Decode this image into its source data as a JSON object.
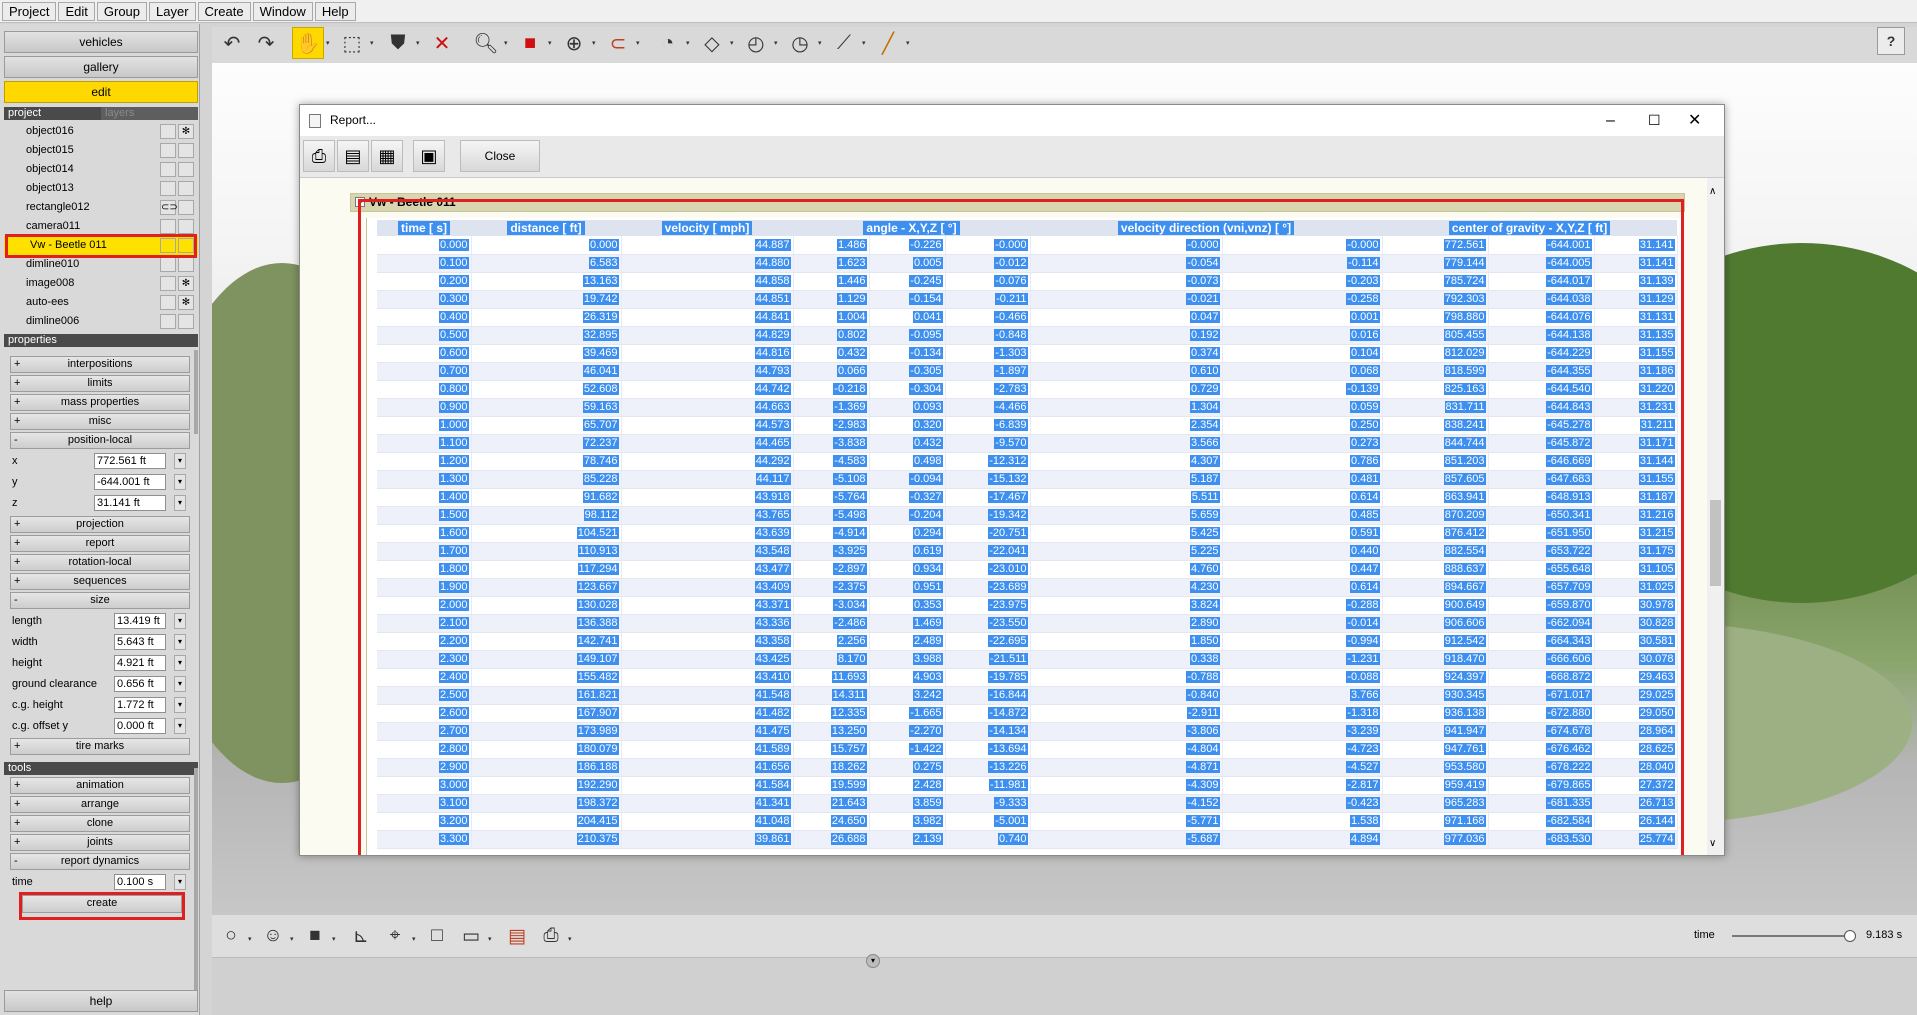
{
  "menu": [
    "Project",
    "Edit",
    "Group",
    "Layer",
    "Create",
    "Window",
    "Help"
  ],
  "left": {
    "nav": [
      "vehicles",
      "gallery",
      "edit"
    ],
    "tabs": {
      "project": "project",
      "layers": "layers"
    },
    "objects": [
      {
        "label": "object016",
        "flag": "snow"
      },
      {
        "label": "object015",
        "flag": ""
      },
      {
        "label": "object014",
        "flag": ""
      },
      {
        "label": "object013",
        "flag": ""
      },
      {
        "label": "rectangle012",
        "flag": "link"
      },
      {
        "label": "camera011",
        "flag": ""
      },
      {
        "label": "Vw - Beetle 011",
        "flag": ""
      },
      {
        "label": "dimline010",
        "flag": ""
      },
      {
        "label": "image008",
        "flag": "snow"
      },
      {
        "label": "auto-ees",
        "flag": "snow"
      },
      {
        "label": "dimline006",
        "flag": ""
      }
    ],
    "properties_label": "properties",
    "properties": {
      "interpositions": "interpositions",
      "limits": "limits",
      "mass_properties": "mass properties",
      "misc": "misc",
      "position_local": "position-local",
      "x_label": "x",
      "x": "772.561 ft",
      "y_label": "y",
      "y": "-644.001 ft",
      "z_label": "z",
      "z": "31.141 ft",
      "projection": "projection",
      "report": "report",
      "rotation_local": "rotation-local",
      "sequences": "sequences",
      "size": "size",
      "length_label": "length",
      "length": "13.419 ft",
      "width_label": "width",
      "width": "5.643 ft",
      "height_label": "height",
      "height": "4.921 ft",
      "ground_clearance_label": "ground clearance",
      "ground_clearance": "0.656 ft",
      "cg_height_label": "c.g. height",
      "cg_height": "1.772 ft",
      "cg_offset_label": "c.g. offset y",
      "cg_offset": "0.000 ft",
      "tire_marks": "tire marks"
    },
    "tools_label": "tools",
    "tools": {
      "animation": "animation",
      "arrange": "arrange",
      "clone": "clone",
      "joints": "joints",
      "report_dynamics": "report dynamics",
      "time_label": "time",
      "time": "0.100 s",
      "create": "create"
    },
    "help": "help"
  },
  "bottom": {
    "time_label": "time",
    "time_value": "9.183 s",
    "slider_fraction": 0.95
  },
  "dialog": {
    "title": "Report...",
    "close_label": "Close",
    "vehicle": "Vw - Beetle 011",
    "headers": [
      "time [ s]",
      "distance [ ft]",
      "velocity [ mph]",
      "angle - X,Y,Z [ °]",
      "velocity direction (vni,vnz) [ °]",
      "center of gravity - X,Y,Z [ ft]"
    ],
    "rows": [
      [
        "0.000",
        "0.000",
        "44.887",
        "1.486",
        "-0.226",
        "-0.000",
        "-0.000",
        "-0.000",
        "772.561",
        "-644.001",
        "31.141"
      ],
      [
        "0.100",
        "6.583",
        "44.880",
        "1.623",
        "0.005",
        "-0.012",
        "-0.054",
        "-0.114",
        "779.144",
        "-644.005",
        "31.141"
      ],
      [
        "0.200",
        "13.163",
        "44.858",
        "1.446",
        "-0.245",
        "-0.076",
        "-0.073",
        "-0.203",
        "785.724",
        "-644.017",
        "31.139"
      ],
      [
        "0.300",
        "19.742",
        "44.851",
        "1.129",
        "-0.154",
        "-0.211",
        "-0.021",
        "-0.258",
        "792.303",
        "-644.038",
        "31.129"
      ],
      [
        "0.400",
        "26.319",
        "44.841",
        "1.004",
        "0.041",
        "-0.466",
        "0.047",
        "0.001",
        "798.880",
        "-644.076",
        "31.131"
      ],
      [
        "0.500",
        "32.895",
        "44.829",
        "0.802",
        "-0.095",
        "-0.848",
        "0.192",
        "0.016",
        "805.455",
        "-644.138",
        "31.135"
      ],
      [
        "0.600",
        "39.469",
        "44.816",
        "0.432",
        "-0.134",
        "-1.303",
        "0.374",
        "0.104",
        "812.029",
        "-644.229",
        "31.155"
      ],
      [
        "0.700",
        "46.041",
        "44.793",
        "0.066",
        "-0.305",
        "-1.897",
        "0.610",
        "0.068",
        "818.599",
        "-644.355",
        "31.186"
      ],
      [
        "0.800",
        "52.608",
        "44.742",
        "-0.218",
        "-0.304",
        "-2.783",
        "0.729",
        "-0.139",
        "825.163",
        "-644.540",
        "31.220"
      ],
      [
        "0.900",
        "59.163",
        "44.663",
        "-1.369",
        "0.093",
        "-4.466",
        "1.304",
        "0.059",
        "831.711",
        "-644.843",
        "31.231"
      ],
      [
        "1.000",
        "65.707",
        "44.573",
        "-2.983",
        "0.320",
        "-6.839",
        "2.354",
        "0.250",
        "838.241",
        "-645.278",
        "31.211"
      ],
      [
        "1.100",
        "72.237",
        "44.465",
        "-3.838",
        "0.432",
        "-9.570",
        "3.566",
        "0.273",
        "844.744",
        "-645.872",
        "31.171"
      ],
      [
        "1.200",
        "78.746",
        "44.292",
        "-4.583",
        "0.498",
        "-12.312",
        "4.307",
        "0.786",
        "851.203",
        "-646.669",
        "31.144"
      ],
      [
        "1.300",
        "85.228",
        "44.117",
        "-5.108",
        "-0.094",
        "-15.132",
        "5.187",
        "0.481",
        "857.605",
        "-647.683",
        "31.155"
      ],
      [
        "1.400",
        "91.682",
        "43.918",
        "-5.764",
        "-0.327",
        "-17.467",
        "5.511",
        "0.614",
        "863.941",
        "-648.913",
        "31.187"
      ],
      [
        "1.500",
        "98.112",
        "43.765",
        "-5.498",
        "-0.204",
        "-19.342",
        "5.659",
        "0.485",
        "870.209",
        "-650.341",
        "31.216"
      ],
      [
        "1.600",
        "104.521",
        "43.639",
        "-4.914",
        "0.294",
        "-20.751",
        "5.425",
        "0.591",
        "876.412",
        "-651.950",
        "31.215"
      ],
      [
        "1.700",
        "110.913",
        "43.548",
        "-3.925",
        "0.619",
        "-22.041",
        "5.225",
        "0.440",
        "882.554",
        "-653.722",
        "31.175"
      ],
      [
        "1.800",
        "117.294",
        "43.477",
        "-2.897",
        "0.934",
        "-23.010",
        "4.760",
        "0.447",
        "888.637",
        "-655.648",
        "31.105"
      ],
      [
        "1.900",
        "123.667",
        "43.409",
        "-2.375",
        "0.951",
        "-23.689",
        "4.230",
        "0.614",
        "894.667",
        "-657.709",
        "31.025"
      ],
      [
        "2.000",
        "130.028",
        "43.371",
        "-3.034",
        "0.353",
        "-23.975",
        "3.824",
        "-0.288",
        "900.649",
        "-659.870",
        "30.978"
      ],
      [
        "2.100",
        "136.388",
        "43.336",
        "-2.486",
        "1.469",
        "-23.550",
        "2.890",
        "-0.014",
        "906.606",
        "-662.094",
        "30.828"
      ],
      [
        "2.200",
        "142.741",
        "43.358",
        "2.256",
        "2.489",
        "-22.695",
        "1.850",
        "-0.994",
        "912.542",
        "-664.343",
        "30.581"
      ],
      [
        "2.300",
        "149.107",
        "43.425",
        "8.170",
        "3.988",
        "-21.511",
        "0.338",
        "-1.231",
        "918.470",
        "-666.606",
        "30.078"
      ],
      [
        "2.400",
        "155.482",
        "43.410",
        "11.693",
        "4.903",
        "-19.785",
        "-0.788",
        "-0.088",
        "924.397",
        "-668.872",
        "29.463"
      ],
      [
        "2.500",
        "161.821",
        "41.548",
        "14.311",
        "3.242",
        "-16.844",
        "-0.840",
        "3.766",
        "930.345",
        "-671.017",
        "29.025"
      ],
      [
        "2.600",
        "167.907",
        "41.482",
        "12.335",
        "-1.665",
        "-14.872",
        "-2.911",
        "-1.318",
        "936.138",
        "-672.880",
        "29.050"
      ],
      [
        "2.700",
        "173.989",
        "41.475",
        "13.250",
        "-2.270",
        "-14.134",
        "-3.806",
        "-3.239",
        "941.947",
        "-674.678",
        "28.964"
      ],
      [
        "2.800",
        "180.079",
        "41.589",
        "15.757",
        "-1.422",
        "-13.694",
        "-4.804",
        "-4.723",
        "947.761",
        "-676.462",
        "28.625"
      ],
      [
        "2.900",
        "186.188",
        "41.656",
        "18.262",
        "0.275",
        "-13.226",
        "-4.871",
        "-4.527",
        "953.580",
        "-678.222",
        "28.040"
      ],
      [
        "3.000",
        "192.290",
        "41.584",
        "19.599",
        "2.428",
        "-11.981",
        "-4.309",
        "-2.817",
        "959.419",
        "-679.865",
        "27.372"
      ],
      [
        "3.100",
        "198.372",
        "41.341",
        "21.643",
        "3.859",
        "-9.333",
        "-4.152",
        "-0.423",
        "965.283",
        "-681.335",
        "26.713"
      ],
      [
        "3.200",
        "204.415",
        "41.048",
        "24.650",
        "3.982",
        "-5.001",
        "-5.771",
        "1.538",
        "971.168",
        "-682.584",
        "26.144"
      ],
      [
        "3.300",
        "210.375",
        "39.861",
        "26.688",
        "2.139",
        "0.740",
        "-5.687",
        "4.894",
        "977.036",
        "-683.530",
        "25.774"
      ]
    ]
  }
}
